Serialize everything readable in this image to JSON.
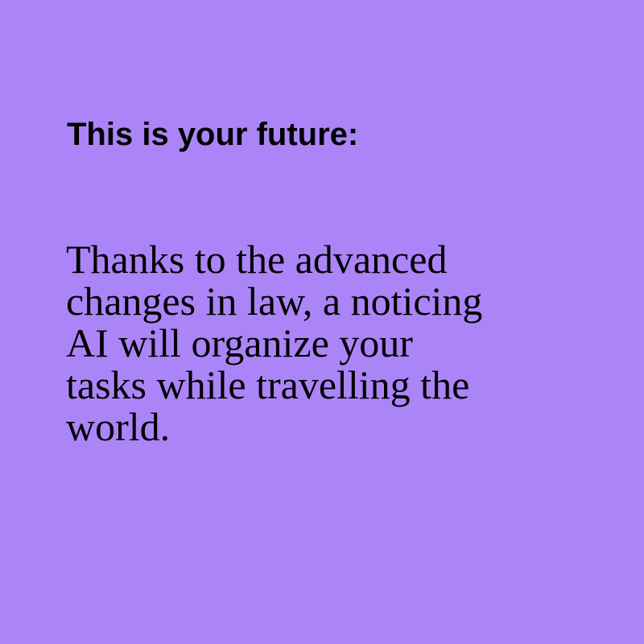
{
  "background_color": "#ab85f8",
  "text_color": "#000000",
  "headline": "This is your future:",
  "body_lines": [
    "Thanks to the advanced",
    "changes in law, a noticing",
    "AI will organize your",
    "tasks while travelling the",
    "world."
  ]
}
